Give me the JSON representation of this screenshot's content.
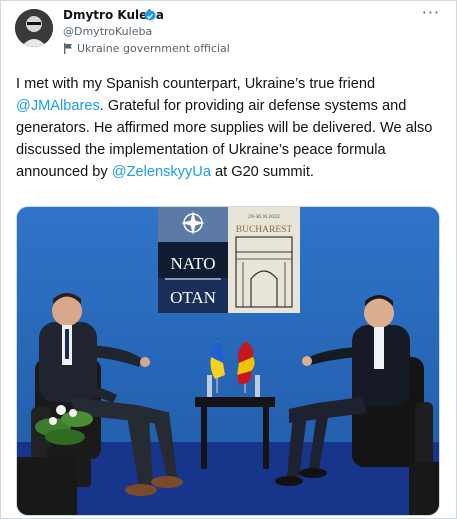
{
  "author": {
    "name": "Dmytro Kuleba",
    "handle": "@DmytroKuleba",
    "label": "Ukraine government official"
  },
  "tweet": {
    "text_1": "I met with my Spanish counterpart, Ukraine’s true friend ",
    "mention_1": "@JMAlbares",
    "text_2": ". Grateful for providing air defense systems and generators. He affirmed more supplies will be delivered. We also discussed the implementation of Ukraine’s peace formula announced by ",
    "mention_2": "@ZelenskyyUa",
    "text_3": " at G20 summit."
  },
  "photo": {
    "sign_left_top": "NATO",
    "sign_left_bottom": "OTAN",
    "sign_right_date": "29-30.XI.2022",
    "sign_right_city": "BUCHAREST"
  },
  "icons": {
    "more": "more-icon",
    "verified": "verified-badge-icon",
    "label": "flag-icon"
  },
  "colors": {
    "link": "#1d9bf0",
    "verified": "#1d9bf0"
  }
}
